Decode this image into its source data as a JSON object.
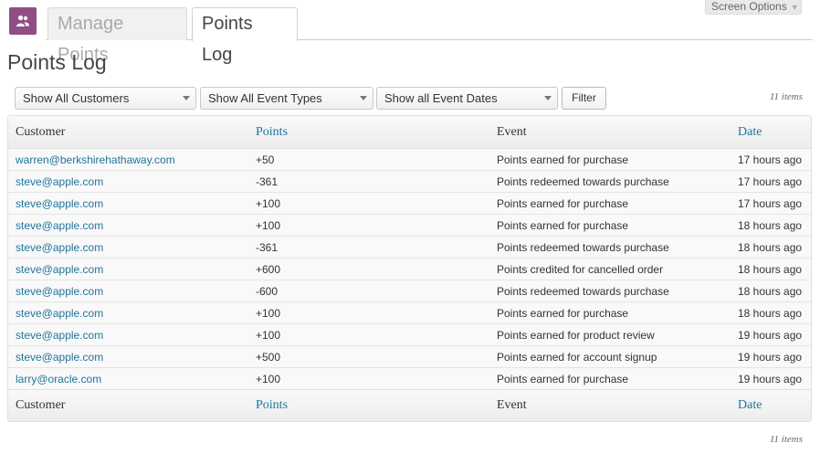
{
  "screen_options": {
    "label": "Screen Options"
  },
  "tabs": [
    {
      "label": "Manage Points"
    },
    {
      "label": "Points Log"
    }
  ],
  "page_title": "Points Log",
  "filters": {
    "customers": "Show All Customers",
    "event_types": "Show All Event Types",
    "event_dates": "Show all Event Dates",
    "filter_button": "Filter"
  },
  "item_count": "11 items",
  "columns": [
    "Customer",
    "Points",
    "Event",
    "Date"
  ],
  "rows": [
    {
      "customer": "warren@berkshirehathaway.com",
      "points": "+50",
      "event": "Points earned for purchase",
      "date": "17 hours ago"
    },
    {
      "customer": "steve@apple.com",
      "points": "-361",
      "event": "Points redeemed towards purchase",
      "date": "17 hours ago"
    },
    {
      "customer": "steve@apple.com",
      "points": "+100",
      "event": "Points earned for purchase",
      "date": "17 hours ago"
    },
    {
      "customer": "steve@apple.com",
      "points": "+100",
      "event": "Points earned for purchase",
      "date": "18 hours ago"
    },
    {
      "customer": "steve@apple.com",
      "points": "-361",
      "event": "Points redeemed towards purchase",
      "date": "18 hours ago"
    },
    {
      "customer": "steve@apple.com",
      "points": "+600",
      "event": "Points credited for cancelled order",
      "date": "18 hours ago"
    },
    {
      "customer": "steve@apple.com",
      "points": "-600",
      "event": "Points redeemed towards purchase",
      "date": "18 hours ago"
    },
    {
      "customer": "steve@apple.com",
      "points": "+100",
      "event": "Points earned for purchase",
      "date": "18 hours ago"
    },
    {
      "customer": "steve@apple.com",
      "points": "+100",
      "event": "Points earned for product review",
      "date": "19 hours ago"
    },
    {
      "customer": "steve@apple.com",
      "points": "+500",
      "event": "Points earned for account signup",
      "date": "19 hours ago"
    },
    {
      "customer": "larry@oracle.com",
      "points": "+100",
      "event": "Points earned for purchase",
      "date": "19 hours ago"
    }
  ],
  "colors": {
    "link": "#21759b",
    "plugin_icon": "#8f4f85"
  }
}
